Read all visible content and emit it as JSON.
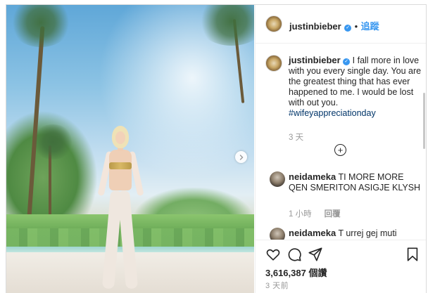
{
  "post": {
    "author": "justinbieber",
    "follow_label": "追蹤",
    "caption_text": "I fall more in love with you every single day. You are the greatest thing that has ever happened to me. I would be lost with out you.",
    "hashtag": "#wifeyappreciationday",
    "caption_time": "3 天",
    "likes_count": "3,616,387",
    "likes_label": "個讚",
    "posted_ago": "3 天前"
  },
  "comments": [
    {
      "username": "neidameka",
      "text": "TI MORE MORE QEN SMERITON ASIGJE KLYSH",
      "time": "1 小時",
      "reply_label": "回覆"
    },
    {
      "username": "neidameka",
      "text": "T urrej gej muti"
    }
  ],
  "icons": {
    "verified": "verified-badge-icon",
    "load_more": "plus-circle-icon",
    "like": "heart-icon",
    "comment": "comment-bubble-icon",
    "share": "paper-plane-icon",
    "save": "bookmark-icon",
    "next": "chevron-right-icon"
  },
  "colors": {
    "link_blue": "#3897f0",
    "hashtag": "#003569",
    "muted": "#999999",
    "text": "#262626"
  }
}
